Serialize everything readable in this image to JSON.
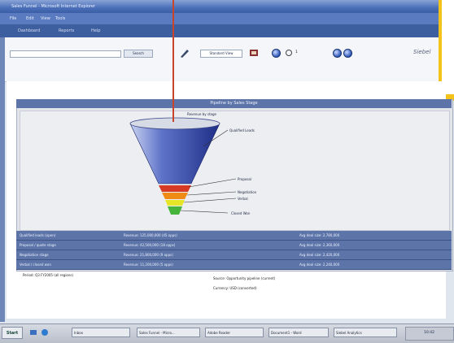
{
  "window": {
    "title": "Sales Funnel - Microsoft Internet Explorer"
  },
  "menu": [
    "File",
    "Edit",
    "View",
    "Tools"
  ],
  "subbar": [
    "Dashboard",
    "Reports",
    "Help"
  ],
  "toolbar": {
    "search_placeholder": "",
    "go_label": "Search",
    "selector_label": "Standard View",
    "page_indicator": "1",
    "brand_text": "Siebel"
  },
  "panel": {
    "title": "Pipeline by Sales Stage",
    "caption": "Revenue by stage"
  },
  "funnel_labels": [
    "Qualified Leads",
    "Proposal",
    "Negotiation",
    "Verbal",
    "Closed Won"
  ],
  "table": {
    "rows": [
      [
        "Qualified leads (open)",
        "Revenue: 125,000,000 (45 opps)",
        "Avg deal size: 2,780,000"
      ],
      [
        "Proposal / quote stage",
        "Revenue: 42,500,000 (18 opps)",
        "Avg deal size: 2,360,000"
      ],
      [
        "Negotiation stage",
        "Revenue: 21,800,000 (9 opps)",
        "Avg deal size: 2,420,000"
      ],
      [
        "Verbal / closed won",
        "Revenue: 11,200,000 (5 opps)",
        "Avg deal size: 2,240,000"
      ]
    ]
  },
  "legend": [
    "Period: Q3 FY2005 (all regions)",
    "Source: Opportunity pipeline (current)",
    "Currency: USD (converted)"
  ],
  "taskbar": {
    "start": "Start",
    "items": [
      "Inbox",
      "Sales Funnel - Micro...",
      "Adobe Reader",
      "Document1 - Word",
      "Siebel Analytics"
    ],
    "clock": "10:42"
  },
  "colors": {
    "funnel_top": "#2e3f9e",
    "funnel_red": "#d63a22",
    "funnel_orange": "#ef8a14",
    "funnel_yellow": "#e6e52a",
    "funnel_green": "#46b43a",
    "callout": "#f3c319"
  }
}
